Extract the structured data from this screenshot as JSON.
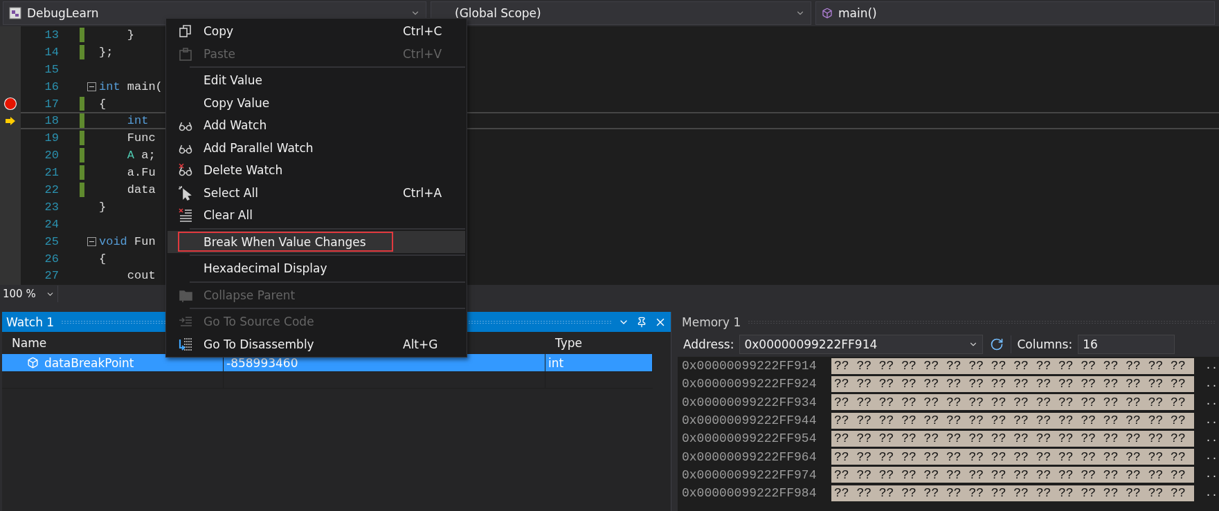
{
  "navigation_bar": {
    "project": "DebugLearn",
    "scope": "(Global Scope)",
    "function": "main()"
  },
  "editor": {
    "lines": [
      {
        "number": "13",
        "tokens": [
          {
            "text": "    }",
            "kind": "plain"
          }
        ],
        "breakpoint": false,
        "current": false,
        "changed": true,
        "foldable": false
      },
      {
        "number": "14",
        "tokens": [
          {
            "text": "};",
            "kind": "plain"
          }
        ],
        "breakpoint": false,
        "current": false,
        "changed": true,
        "foldable": false
      },
      {
        "number": "15",
        "breakpoint": false,
        "current": false,
        "changed": false,
        "foldable": false
      },
      {
        "number": "16",
        "tokens": [
          {
            "text": "int",
            "kind": "keyword"
          },
          {
            "text": " main(",
            "kind": "plain"
          }
        ],
        "breakpoint": false,
        "current": false,
        "changed": false,
        "foldable": true
      },
      {
        "number": "17",
        "tokens": [
          {
            "text": "{",
            "kind": "plain"
          }
        ],
        "breakpoint": true,
        "current": false,
        "changed": true,
        "foldable": false
      },
      {
        "number": "18",
        "tokens": [
          {
            "text": "    int",
            "kind": "keyword"
          }
        ],
        "breakpoint": false,
        "current": true,
        "changed": true,
        "foldable": false
      },
      {
        "number": "19",
        "tokens": [
          {
            "text": "    Func",
            "kind": "plain"
          }
        ],
        "breakpoint": false,
        "current": false,
        "changed": true,
        "foldable": false
      },
      {
        "number": "20",
        "tokens": [
          {
            "text": "    A",
            "kind": "type"
          },
          {
            "text": " a;",
            "kind": "plain"
          }
        ],
        "breakpoint": false,
        "current": false,
        "changed": true,
        "foldable": false
      },
      {
        "number": "21",
        "tokens": [
          {
            "text": "    a.Fu",
            "kind": "plain"
          }
        ],
        "breakpoint": false,
        "current": false,
        "changed": true,
        "foldable": false
      },
      {
        "number": "22",
        "tokens": [
          {
            "text": "    data",
            "kind": "plain"
          }
        ],
        "breakpoint": false,
        "current": false,
        "changed": true,
        "foldable": false
      },
      {
        "number": "23",
        "tokens": [
          {
            "text": "}",
            "kind": "plain"
          }
        ],
        "breakpoint": false,
        "current": false,
        "changed": false,
        "foldable": false
      },
      {
        "number": "24",
        "breakpoint": false,
        "current": false,
        "changed": false,
        "foldable": false
      },
      {
        "number": "25",
        "tokens": [
          {
            "text": "void",
            "kind": "keyword"
          },
          {
            "text": " Fun",
            "kind": "plain"
          }
        ],
        "breakpoint": false,
        "current": false,
        "changed": false,
        "foldable": true
      },
      {
        "number": "26",
        "tokens": [
          {
            "text": "{",
            "kind": "plain"
          }
        ],
        "breakpoint": false,
        "current": false,
        "changed": false,
        "foldable": false
      },
      {
        "number": "27",
        "tokens": [
          {
            "text": "    cout",
            "kind": "plain"
          }
        ],
        "breakpoint": false,
        "current": false,
        "changed": false,
        "foldable": false
      }
    ],
    "zoom": "100 %"
  },
  "context_menu": {
    "groups": [
      {
        "items": [
          {
            "label": "Copy",
            "shortcut": "Ctrl+C",
            "disabled": false,
            "selected": false,
            "outlined": false
          },
          {
            "label": "Paste",
            "shortcut": "Ctrl+V",
            "disabled": true,
            "selected": false,
            "outlined": false
          }
        ]
      },
      {
        "items": [
          {
            "label": "Edit Value",
            "disabled": false,
            "selected": false,
            "outlined": false
          },
          {
            "label": "Copy Value",
            "disabled": false,
            "selected": false,
            "outlined": false
          },
          {
            "label": "Add Watch",
            "disabled": false,
            "selected": false,
            "outlined": false
          },
          {
            "label": "Add Parallel Watch",
            "disabled": false,
            "selected": false,
            "outlined": false
          },
          {
            "label": "Delete Watch",
            "disabled": false,
            "selected": false,
            "outlined": false
          },
          {
            "label": "Select All",
            "shortcut": "Ctrl+A",
            "disabled": false,
            "selected": false,
            "outlined": false
          },
          {
            "label": "Clear All",
            "disabled": false,
            "selected": false,
            "outlined": false
          }
        ]
      },
      {
        "items": [
          {
            "label": "Break When Value Changes",
            "disabled": false,
            "selected": true,
            "outlined": true
          }
        ]
      },
      {
        "items": [
          {
            "label": "Hexadecimal Display",
            "disabled": false,
            "selected": false,
            "outlined": false
          }
        ]
      },
      {
        "items": [
          {
            "label": "Collapse Parent",
            "disabled": true,
            "selected": false,
            "outlined": false
          }
        ]
      },
      {
        "items": [
          {
            "label": "Go To Source Code",
            "disabled": true,
            "selected": false,
            "outlined": false
          },
          {
            "label": "Go To Disassembly",
            "shortcut": "Alt+G",
            "disabled": false,
            "selected": false,
            "outlined": false
          }
        ]
      }
    ]
  },
  "watch": {
    "title": "Watch 1",
    "columns": [
      "Name",
      "Type"
    ],
    "rows": [
      {
        "name": "dataBreakPoint",
        "value": "-858993460",
        "type": "int",
        "selected": true
      }
    ]
  },
  "memory": {
    "title": "Memory 1",
    "address_label": "Address:",
    "address": "0x00000099222FF914",
    "columns_label": "Columns:",
    "columns": "16",
    "rows": [
      {
        "address": "0x00000099222FF914",
        "bytes": "?? ?? ?? ?? ?? ?? ?? ?? ?? ?? ?? ?? ?? ?? ?? ??",
        "ascii": ".."
      },
      {
        "address": "0x00000099222FF924",
        "bytes": "?? ?? ?? ?? ?? ?? ?? ?? ?? ?? ?? ?? ?? ?? ?? ??",
        "ascii": ".."
      },
      {
        "address": "0x00000099222FF934",
        "bytes": "?? ?? ?? ?? ?? ?? ?? ?? ?? ?? ?? ?? ?? ?? ?? ??",
        "ascii": ".."
      },
      {
        "address": "0x00000099222FF944",
        "bytes": "?? ?? ?? ?? ?? ?? ?? ?? ?? ?? ?? ?? ?? ?? ?? ??",
        "ascii": ".."
      },
      {
        "address": "0x00000099222FF954",
        "bytes": "?? ?? ?? ?? ?? ?? ?? ?? ?? ?? ?? ?? ?? ?? ?? ??",
        "ascii": ".."
      },
      {
        "address": "0x00000099222FF964",
        "bytes": "?? ?? ?? ?? ?? ?? ?? ?? ?? ?? ?? ?? ?? ?? ?? ??",
        "ascii": ".."
      },
      {
        "address": "0x00000099222FF974",
        "bytes": "?? ?? ?? ?? ?? ?? ?? ?? ?? ?? ?? ?? ?? ?? ?? ??",
        "ascii": ".."
      },
      {
        "address": "0x00000099222FF984",
        "bytes": "?? ?? ?? ?? ?? ?? ?? ?? ?? ?? ?? ?? ?? ?? ?? ??",
        "ascii": ".."
      }
    ]
  }
}
